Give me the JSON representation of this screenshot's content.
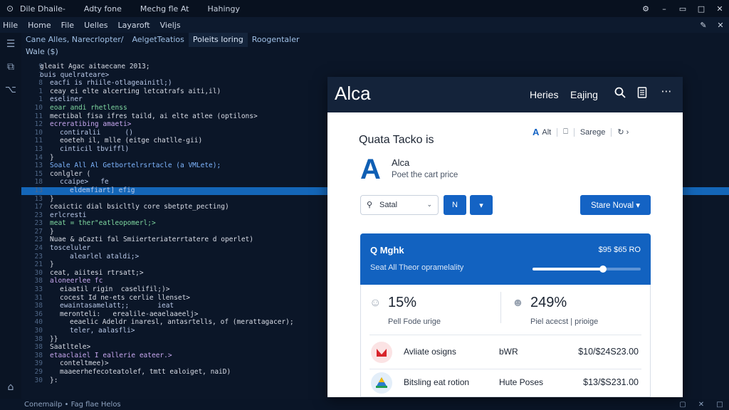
{
  "titlebar": {
    "menus": [
      "Dile Dhaile-",
      "Adty fone",
      "Mechg fle At",
      "Hahingy"
    ]
  },
  "menubar": {
    "items": [
      "Hile",
      "Home",
      "File",
      "Uelles",
      "Layaroft",
      "Vieljs"
    ]
  },
  "editor": {
    "tabs": [
      "Cane Alles, Narecrlopter/",
      "AelgetTeatios",
      "Poleits Ioring",
      "Roogentaler"
    ],
    "subline": "Wale ($)",
    "lines": [
      {
        "n": "9",
        "t": "gleait Agac aitaecane 2013;",
        "c": "c-key",
        "i": 6
      },
      {
        "n": "1",
        "t": "ouis quelrateare>",
        "c": "c-str",
        "i": 6
      },
      {
        "n": "8",
        "t": "eacfi is rhiile-otlageainitl;)",
        "c": "c-str",
        "i": 20
      },
      {
        "n": "1",
        "t": "ceay ei elte alcerting letcatrafs aiti,il)",
        "c": "c-key",
        "i": 20
      },
      {
        "n": "1",
        "t": "eseliner",
        "c": "c-str",
        "i": 20
      },
      {
        "n": "10",
        "t": "eoar andi rhetlenss",
        "c": "c-grn",
        "i": 20
      },
      {
        "n": "11",
        "t": "mectibal fisa ifres taild, ai elte atlee (optilons>",
        "c": "c-key",
        "i": 20
      },
      {
        "n": "12",
        "t": "ecreratibing amaeti>",
        "c": "c-pur",
        "i": 20
      },
      {
        "n": "10",
        "t": "contiralii      ()",
        "c": "c-str",
        "i": 34
      },
      {
        "n": "11",
        "t": "eoeteh il, mlle (eitge chatlle-gii)",
        "c": "c-key",
        "i": 34
      },
      {
        "n": "13",
        "t": "cinticil tbviffl)",
        "c": "c-str",
        "i": 34
      },
      {
        "n": "14",
        "t": "}",
        "c": "c-key",
        "i": 20
      },
      {
        "n": "13",
        "t": "Soale All Al Getbortelrsrtacle (a VMLete);",
        "c": "c-blu",
        "i": 20
      },
      {
        "n": "15",
        "t": "conlgler (",
        "c": "c-key",
        "i": 20
      },
      {
        "n": "18",
        "t": "ccaipe>   fe",
        "c": "c-str",
        "i": 34
      },
      {
        "n": "13",
        "t": "eldemfiart] efig",
        "c": "c-str",
        "i": 48
      },
      {
        "n": "13",
        "t": "}",
        "c": "c-key",
        "i": 20
      },
      {
        "n": "17",
        "t": "ceaictic dial bsicltly core sbetpte_pecting)",
        "c": "c-key",
        "i": 20
      },
      {
        "n": "23",
        "t": "erlcresti",
        "c": "c-str",
        "i": 20
      },
      {
        "n": "23",
        "t": "meat = ther\"eatleopomerl;>",
        "c": "c-grn",
        "i": 20
      },
      {
        "n": "27",
        "t": "}",
        "c": "c-key",
        "i": 20
      },
      {
        "n": "23",
        "t": "Nuae & aCazti fal Smiierteriaterrtatere d operlet)",
        "c": "c-key",
        "i": 20
      },
      {
        "n": "24",
        "t": "tosceluler",
        "c": "c-str",
        "i": 20
      },
      {
        "n": "23",
        "t": "alearlel ataldi;>",
        "c": "c-str",
        "i": 48
      },
      {
        "n": "21",
        "t": "}",
        "c": "c-key",
        "i": 20
      },
      {
        "n": "30",
        "t": "ceat, aiitesi rtrsatt;>",
        "c": "c-key",
        "i": 20
      },
      {
        "n": "38",
        "t": "aloneerlee fc",
        "c": "c-pur",
        "i": 20
      },
      {
        "n": "33",
        "t": "eiaatil rigin  caselifil;)>",
        "c": "c-key",
        "i": 34
      },
      {
        "n": "31",
        "t": "cocest Id ne-ets cerlie llenset>",
        "c": "c-key",
        "i": 34
      },
      {
        "n": "38",
        "t": "ewaintasamelatt;;       ieat",
        "c": "c-str",
        "i": 34
      },
      {
        "n": "36",
        "t": "meronteli:   erealile-aeaelaaeelj>",
        "c": "c-key",
        "i": 34
      },
      {
        "n": "40",
        "t": "eeaelic Adeldr inaresl, antasrtells, of (merattagacer);",
        "c": "c-key",
        "i": 48
      },
      {
        "n": "30",
        "t": "teler, aalasfli>",
        "c": "c-str",
        "i": 48
      },
      {
        "n": "38",
        "t": "}}",
        "c": "c-key",
        "i": 20
      },
      {
        "n": "38",
        "t": "Saatltele>",
        "c": "c-key",
        "i": 20
      },
      {
        "n": "38",
        "t": "etaaclaiel I eallerie eateer.>",
        "c": "c-pur",
        "i": 20
      },
      {
        "n": "39",
        "t": "conteltmee)>",
        "c": "c-key",
        "i": 34
      },
      {
        "n": "29",
        "t": "maaeerhefecoteatolef, tmtt ealoiget, naiD)",
        "c": "c-key",
        "i": 34
      },
      {
        "n": "30",
        "t": "}:",
        "c": "c-key",
        "i": 20
      }
    ]
  },
  "statusbar": {
    "left": "Conemailp • Fag flae Helos"
  },
  "app": {
    "brand": "Alca",
    "nav": [
      "Heries",
      "Eajing"
    ],
    "section_title": "Quata Tacko is",
    "toplinks": [
      "A̲",
      "Alt",
      "Sarege",
      "⊃"
    ],
    "product_name": "Alca",
    "product_sub": "Poet the cart price",
    "select_value": "Satal",
    "btn_small_label": "N",
    "btn_dropdown_label": "▾",
    "primary_button": "Stare Noval ▾",
    "card": {
      "title": "Q Mghk",
      "amount": "$95 $65 RO",
      "subtitle": "Seat All Theor opramelality",
      "progress": 0.65
    },
    "stats": [
      {
        "value": "15%",
        "label": "Pell Fode urige"
      },
      {
        "value": "249%",
        "label": "Piel acecst | prioige"
      }
    ],
    "rows": [
      {
        "name": "Avliate osigns",
        "mid": "bWR",
        "amount": "$10/$24S23.00"
      },
      {
        "name": "Bitsling eat rotion",
        "mid": "Hute Poses",
        "amount": "$13/$S231.00"
      }
    ],
    "colors": {
      "accent": "#1463c4",
      "header": "#14233a",
      "row1_icon": "#d8242b",
      "row2_icon": "#2b7bd0"
    }
  }
}
